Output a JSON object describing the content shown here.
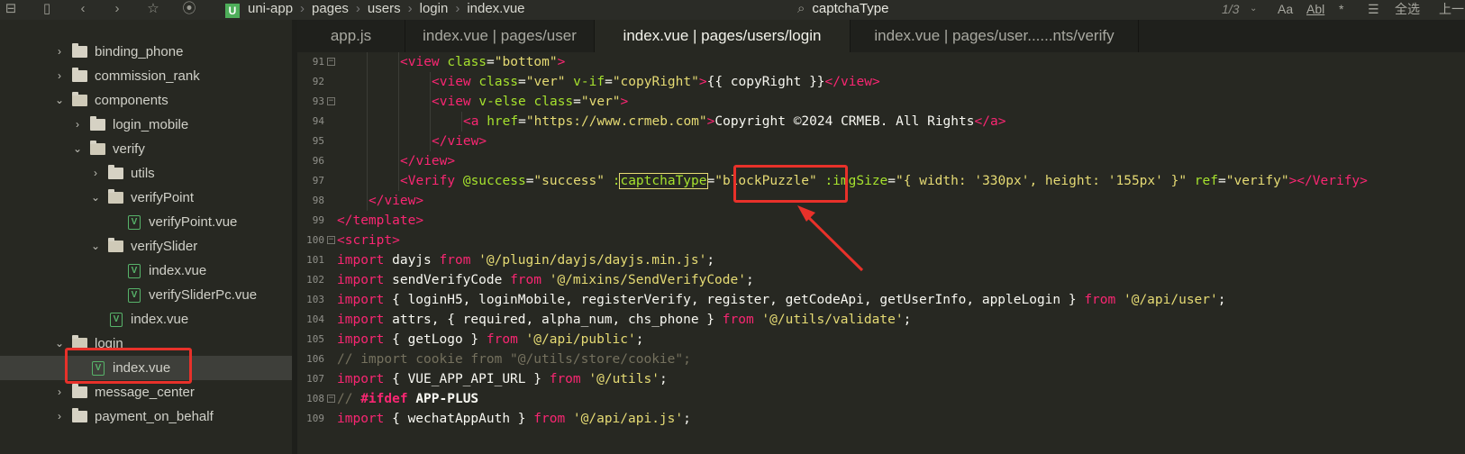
{
  "toolbar": {
    "breadcrumb": [
      "uni-app",
      "pages",
      "users",
      "login",
      "index.vue"
    ],
    "project_badge": "U",
    "search_text": "captchaType",
    "match_count": "1/3",
    "match_case": "Aa",
    "whole_word": "Abl",
    "regex": "*",
    "select_all": "全选",
    "prev": "上一"
  },
  "sidebar": {
    "items": [
      {
        "label": "binding_phone",
        "type": "folder",
        "expanded": false
      },
      {
        "label": "commission_rank",
        "type": "folder",
        "expanded": false
      },
      {
        "label": "components",
        "type": "folder",
        "expanded": true
      },
      {
        "label": "login_mobile",
        "type": "folder",
        "expanded": false
      },
      {
        "label": "verify",
        "type": "folder",
        "expanded": true
      },
      {
        "label": "utils",
        "type": "folder",
        "expanded": false
      },
      {
        "label": "verifyPoint",
        "type": "folder",
        "expanded": true
      },
      {
        "label": "verifyPoint.vue",
        "type": "vue"
      },
      {
        "label": "verifySlider",
        "type": "folder",
        "expanded": true
      },
      {
        "label": "index.vue",
        "type": "vue"
      },
      {
        "label": "verifySliderPc.vue",
        "type": "vue"
      },
      {
        "label": "index.vue",
        "type": "vue"
      },
      {
        "label": "login",
        "type": "folder",
        "expanded": true
      },
      {
        "label": "index.vue",
        "type": "vue",
        "selected": true
      },
      {
        "label": "message_center",
        "type": "folder",
        "expanded": false
      },
      {
        "label": "payment_on_behalf",
        "type": "folder",
        "expanded": false
      }
    ]
  },
  "tabs": [
    {
      "label": "app.js",
      "active": false
    },
    {
      "label": "index.vue | pages/user",
      "active": false
    },
    {
      "label": "index.vue | pages/users/login",
      "active": true
    },
    {
      "label": "index.vue | pages/user......nts/verify",
      "active": false
    }
  ],
  "editor": {
    "line_numbers": [
      "91",
      "92",
      "93",
      "94",
      "95",
      "96",
      "97",
      "98",
      "99",
      "100",
      "101",
      "102",
      "103",
      "104",
      "105",
      "106",
      "107",
      "108",
      "109"
    ],
    "lines": [
      [
        [
          "tg",
          "<"
        ],
        [
          "tg",
          "view "
        ],
        [
          "at",
          "class"
        ],
        [
          "wh",
          "="
        ],
        [
          "st",
          "\"bottom\""
        ],
        [
          "tg",
          ">"
        ]
      ],
      [
        [
          "tg",
          "<"
        ],
        [
          "tg",
          "view "
        ],
        [
          "at",
          "class"
        ],
        [
          "wh",
          "="
        ],
        [
          "st",
          "\"ver\" "
        ],
        [
          "at",
          "v-if"
        ],
        [
          "wh",
          "="
        ],
        [
          "st",
          "\"copyRight\""
        ],
        [
          "tg",
          ">"
        ],
        [
          "wh",
          "{{ copyRight }}"
        ],
        [
          "tg",
          "</"
        ],
        [
          "tg",
          "view"
        ],
        [
          "tg",
          ">"
        ]
      ],
      [
        [
          "tg",
          "<"
        ],
        [
          "tg",
          "view "
        ],
        [
          "at",
          "v-else "
        ],
        [
          "at",
          "class"
        ],
        [
          "wh",
          "="
        ],
        [
          "st",
          "\"ver\""
        ],
        [
          "tg",
          ">"
        ]
      ],
      [
        [
          "tg",
          "<"
        ],
        [
          "tg",
          "a "
        ],
        [
          "at",
          "href"
        ],
        [
          "wh",
          "="
        ],
        [
          "st",
          "\"https://www.crmeb.com\""
        ],
        [
          "tg",
          ">"
        ],
        [
          "wh",
          "Copyright ©2024 CRMEB. All Rights"
        ],
        [
          "tg",
          "</"
        ],
        [
          "tg",
          "a"
        ],
        [
          "tg",
          ">"
        ]
      ],
      [
        [
          "tg",
          "</"
        ],
        [
          "tg",
          "view"
        ],
        [
          "tg",
          ">"
        ]
      ],
      [
        [
          "tg",
          "</"
        ],
        [
          "tg",
          "view"
        ],
        [
          "tg",
          ">"
        ]
      ],
      [
        [
          "tg",
          "<"
        ],
        [
          "tg",
          "Verify "
        ],
        [
          "at",
          "@success"
        ],
        [
          "wh",
          "="
        ],
        [
          "st",
          "\"success\" "
        ],
        [
          "at",
          ":"
        ],
        [
          "at",
          "captchaType"
        ],
        [
          "wh",
          "="
        ],
        [
          "st",
          "\"blockPuzzle\" "
        ],
        [
          "at",
          ":imgSize"
        ],
        [
          "wh",
          "="
        ],
        [
          "st",
          "\"{ width: "
        ],
        [
          "st",
          "'330px'"
        ],
        [
          "st",
          ", height: "
        ],
        [
          "st",
          "'155px'"
        ],
        [
          "st",
          " }\" "
        ],
        [
          "at",
          "ref"
        ],
        [
          "wh",
          "="
        ],
        [
          "st",
          "\"verify\""
        ],
        [
          "tg",
          "></"
        ],
        [
          "tg",
          "Verify"
        ],
        [
          "tg",
          ">"
        ]
      ],
      [
        [
          "tg",
          "</"
        ],
        [
          "tg",
          "view"
        ],
        [
          "tg",
          ">"
        ]
      ],
      [
        [
          "tg",
          "</"
        ],
        [
          "tg",
          "template"
        ],
        [
          "tg",
          ">"
        ]
      ],
      [
        [
          "tg",
          "<"
        ],
        [
          "tg",
          "script"
        ],
        [
          "tg",
          ">"
        ]
      ],
      [
        [
          "kw",
          "import "
        ],
        [
          "wh",
          "dayjs "
        ],
        [
          "kw",
          "from "
        ],
        [
          "st",
          "'@/plugin/dayjs/dayjs.min.js'"
        ],
        [
          "wh",
          ";"
        ]
      ],
      [
        [
          "kw",
          "import "
        ],
        [
          "wh",
          "sendVerifyCode "
        ],
        [
          "kw",
          "from "
        ],
        [
          "st",
          "'@/mixins/SendVerifyCode'"
        ],
        [
          "wh",
          ";"
        ]
      ],
      [
        [
          "kw",
          "import "
        ],
        [
          "wh",
          "{ loginH5, loginMobile, registerVerify, register, getCodeApi, getUserInfo, appleLogin } "
        ],
        [
          "kw",
          "from "
        ],
        [
          "st",
          "'@/api/user'"
        ],
        [
          "wh",
          ";"
        ]
      ],
      [
        [
          "kw",
          "import "
        ],
        [
          "wh",
          "attrs, { required, alpha_num, chs_phone } "
        ],
        [
          "kw",
          "from "
        ],
        [
          "st",
          "'@/utils/validate'"
        ],
        [
          "wh",
          ";"
        ]
      ],
      [
        [
          "kw",
          "import "
        ],
        [
          "wh",
          "{ getLogo } "
        ],
        [
          "kw",
          "from "
        ],
        [
          "st",
          "'@/api/public'"
        ],
        [
          "wh",
          ";"
        ]
      ],
      [
        [
          "cm",
          "// import cookie from \"@/utils/store/cookie\";"
        ]
      ],
      [
        [
          "kw",
          "import "
        ],
        [
          "wh",
          "{ VUE_APP_API_URL } "
        ],
        [
          "kw",
          "from "
        ],
        [
          "st",
          "'@/utils'"
        ],
        [
          "wh",
          ";"
        ]
      ],
      [
        [
          "cm",
          "// "
        ],
        [
          "kw",
          "#ifdef "
        ],
        [
          "wh",
          "APP-PLUS"
        ]
      ],
      [
        [
          "kw",
          "import "
        ],
        [
          "wh",
          "{ wechatAppAuth } "
        ],
        [
          "kw",
          "from "
        ],
        [
          "st",
          "'@/api/api.js'"
        ],
        [
          "wh",
          ";"
        ]
      ]
    ],
    "indents": [
      2,
      3,
      3,
      4,
      3,
      2,
      2,
      1,
      0,
      0,
      0,
      0,
      0,
      0,
      0,
      0,
      0,
      0,
      0
    ],
    "foldable": [
      true,
      false,
      true,
      false,
      false,
      false,
      false,
      false,
      false,
      true,
      false,
      false,
      false,
      false,
      false,
      false,
      false,
      true,
      false
    ]
  }
}
